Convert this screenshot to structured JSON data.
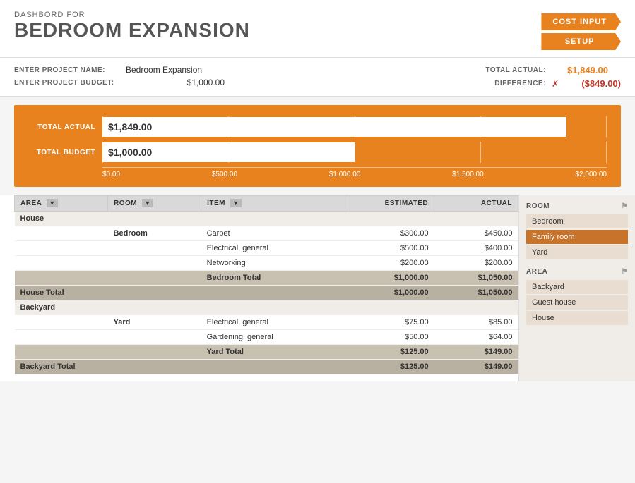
{
  "header": {
    "dashbord_for": "DASHBORD FOR",
    "project_title": "BEDROOM EXPANSION",
    "nav_btn1": "COST INPUT",
    "nav_btn2": "SETUP"
  },
  "project_info": {
    "name_label": "ENTER PROJECT NAME:",
    "name_value": "Bedroom Expansion",
    "budget_label": "ENTER PROJECT BUDGET:",
    "budget_value": "$1,000.00",
    "total_actual_label": "TOTAL ACTUAL:",
    "total_actual_value": "$1,849.00",
    "difference_label": "DIFFERENCE:",
    "difference_value": "($849.00)"
  },
  "chart": {
    "total_actual_label": "TOTAL ACTUAL",
    "total_budget_label": "TOTAL BUDGET",
    "actual_value": "$1,849.00",
    "budget_value": "$1,000.00",
    "actual_bar_pct": 92,
    "budget_bar_pct": 50,
    "axis_labels": [
      "$0.00",
      "$500.00",
      "$1,000.00",
      "$1,500.00",
      "$2,000.00"
    ]
  },
  "table": {
    "headers": {
      "area": "AREA",
      "room": "ROOM",
      "item": "ITEM",
      "estimated": "ESTIMATED",
      "actual": "ACTUAL"
    },
    "rows": [
      {
        "type": "area",
        "area": "House",
        "room": "",
        "item": "",
        "estimated": "",
        "actual": ""
      },
      {
        "type": "item",
        "area": "",
        "room": "Bedroom",
        "item": "Carpet",
        "estimated": "$300.00",
        "actual": "$450.00"
      },
      {
        "type": "item",
        "area": "",
        "room": "",
        "item": "Electrical, general",
        "estimated": "$500.00",
        "actual": "$400.00"
      },
      {
        "type": "item",
        "area": "",
        "room": "",
        "item": "Networking",
        "estimated": "$200.00",
        "actual": "$200.00"
      },
      {
        "type": "subtotal",
        "area": "",
        "room": "",
        "item": "Bedroom Total",
        "estimated": "$1,000.00",
        "actual": "$1,050.00"
      },
      {
        "type": "total",
        "area": "House Total",
        "room": "",
        "item": "",
        "estimated": "$1,000.00",
        "actual": "$1,050.00"
      },
      {
        "type": "area",
        "area": "Backyard",
        "room": "",
        "item": "",
        "estimated": "",
        "actual": ""
      },
      {
        "type": "item",
        "area": "",
        "room": "Yard",
        "item": "Electrical, general",
        "estimated": "$75.00",
        "actual": "$85.00"
      },
      {
        "type": "item",
        "area": "",
        "room": "",
        "item": "Gardening, general",
        "estimated": "$50.00",
        "actual": "$64.00"
      },
      {
        "type": "subtotal",
        "area": "",
        "room": "",
        "item": "Yard Total",
        "estimated": "$125.00",
        "actual": "$149.00"
      },
      {
        "type": "total",
        "area": "Backyard Total",
        "room": "",
        "item": "",
        "estimated": "$125.00",
        "actual": "$149.00"
      }
    ]
  },
  "filter_panel": {
    "room_title": "ROOM",
    "room_items": [
      {
        "label": "Bedroom",
        "selected": false
      },
      {
        "label": "Family room",
        "selected": true
      },
      {
        "label": "Yard",
        "selected": false
      }
    ],
    "area_title": "AREA",
    "area_items": [
      {
        "label": "Backyard",
        "selected": false
      },
      {
        "label": "Guest house",
        "selected": false
      },
      {
        "label": "House",
        "selected": false
      }
    ]
  }
}
